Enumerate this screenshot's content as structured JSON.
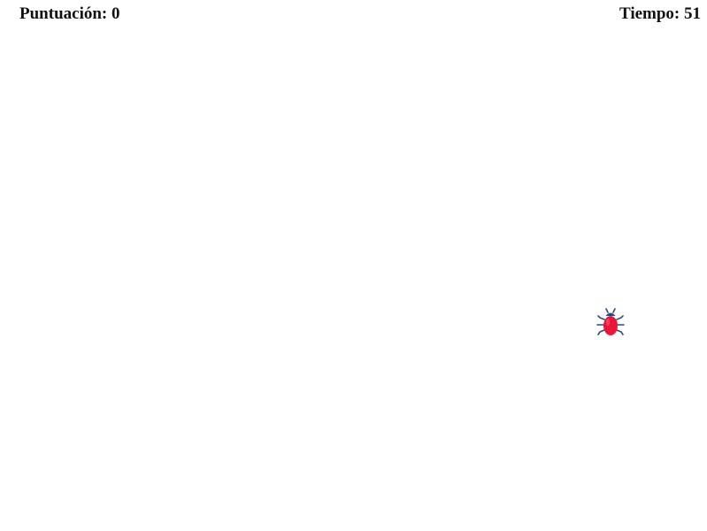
{
  "hud": {
    "score_label": "Puntuación:",
    "score_value": "0",
    "time_label": "Tiempo:",
    "time_value": "51"
  },
  "target": {
    "icon": "ladybug-icon",
    "body_color": "#e8173a",
    "leg_color": "#2c4a7a"
  }
}
